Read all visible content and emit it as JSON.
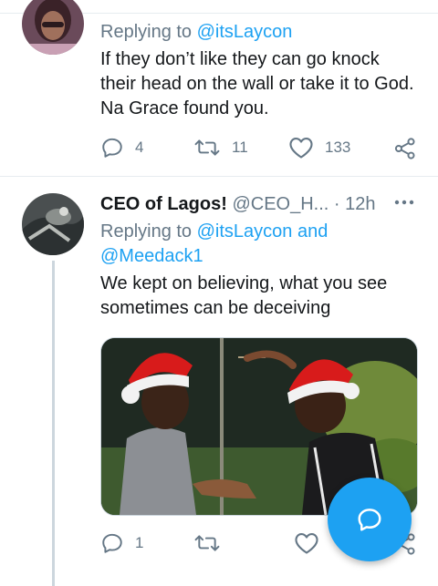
{
  "tweets": [
    {
      "replying_prefix": "Replying to ",
      "replying_to": "@itsLaycon",
      "text": "If they don’t like they can go knock their head on the wall or take it to God. Na Grace found you.",
      "replies": "4",
      "retweets": "11",
      "likes": "133"
    },
    {
      "author_name": "CEO of Lagos!",
      "handle": "@CEO_H...",
      "time": "· 12h",
      "replying_prefix": "Replying to ",
      "replying_to": "@itsLaycon and @Meedack1",
      "text": "We kept on believing, what you see sometimes can be deceiving",
      "replies": "1",
      "retweets": "",
      "likes": ""
    }
  ],
  "icons": {
    "reply": "reply-icon",
    "retweet": "retweet-icon",
    "like": "heart-icon",
    "share": "share-icon",
    "more": "more-icon",
    "compose": "compose-reply-icon"
  },
  "colors": {
    "accent": "#1da1f2",
    "muted": "#657786",
    "text": "#14171a",
    "divider": "#e6ecf0"
  }
}
